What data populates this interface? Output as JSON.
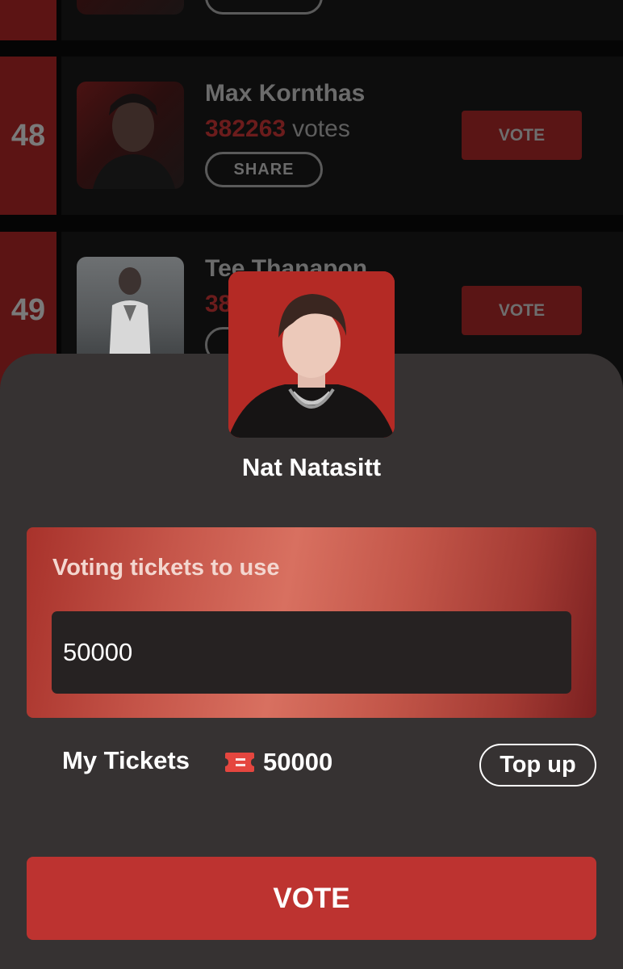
{
  "list": {
    "share_label": "SHARE",
    "vote_label": "VOTE",
    "votes_suffix": "votes",
    "rows": [
      {
        "rank": "48",
        "name": "Max Kornthas",
        "votes": "382263"
      },
      {
        "rank": "49",
        "name": "Tee Thanapon",
        "votes": "38"
      }
    ]
  },
  "sheet": {
    "artist_name": "Nat Natasitt",
    "tickets_label": "Voting tickets to use",
    "tickets_value": "50000",
    "my_tickets_label": "My Tickets",
    "my_tickets_count": "50000",
    "topup_label": "Top up",
    "vote_label": "VOTE"
  },
  "colors": {
    "accent": "#BD3330",
    "sheet_bg": "#363232",
    "panel_gradient_mid": "#D87060"
  },
  "icons": {
    "ticket": "ticket-icon"
  }
}
